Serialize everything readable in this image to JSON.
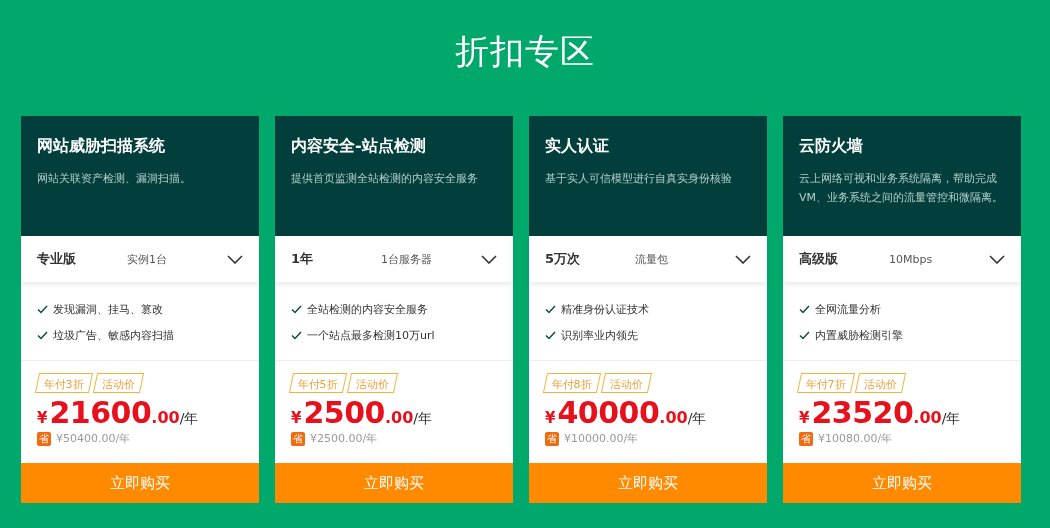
{
  "title": "折扣专区",
  "cards": [
    {
      "name": "网站威胁扫描系统",
      "description": "网站关联资产检测、漏洞扫描。",
      "edition": "专业版",
      "spec": "实例1台",
      "features": [
        "发现漏洞、挂马、篡改",
        "垃圾广告、敏感内容扫描"
      ],
      "tags": [
        "年付3折",
        "活动价"
      ],
      "currency": "¥",
      "price_int": "21600",
      "price_dec": ".00",
      "unit": "/年",
      "save_badge": "省",
      "save_text": "¥50400.00/年",
      "button": "立即购买"
    },
    {
      "name": "内容安全-站点检测",
      "description": "提供首页监测全站检测的内容安全服务",
      "edition": "1年",
      "spec": "1台服务器",
      "features": [
        "全站检测的内容安全服务",
        "一个站点最多检测10万url"
      ],
      "tags": [
        "年付5折",
        "活动价"
      ],
      "currency": "¥",
      "price_int": "2500",
      "price_dec": ".00",
      "unit": "/年",
      "save_badge": "省",
      "save_text": "¥2500.00/年",
      "button": "立即购买"
    },
    {
      "name": "实人认证",
      "description": "基于实人可信模型进行自真实身份核验",
      "edition": "5万次",
      "spec": "流量包",
      "features": [
        "精准身份认证技术",
        "识别率业内领先"
      ],
      "tags": [
        "年付8折",
        "活动价"
      ],
      "currency": "¥",
      "price_int": "40000",
      "price_dec": ".00",
      "unit": "/年",
      "save_badge": "省",
      "save_text": "¥10000.00/年",
      "button": "立即购买"
    },
    {
      "name": "云防火墙",
      "description": "云上网络可视和业务系统隔离，帮助完成VM、业务系统之间的流量管控和微隔离。",
      "edition": "高级版",
      "spec": "10Mbps",
      "features": [
        "全网流量分析",
        "内置威胁检测引擎"
      ],
      "tags": [
        "年付7折",
        "活动价"
      ],
      "currency": "¥",
      "price_int": "23520",
      "price_dec": ".00",
      "unit": "/年",
      "save_badge": "省",
      "save_text": "¥10080.00/年",
      "button": "立即购买"
    }
  ]
}
